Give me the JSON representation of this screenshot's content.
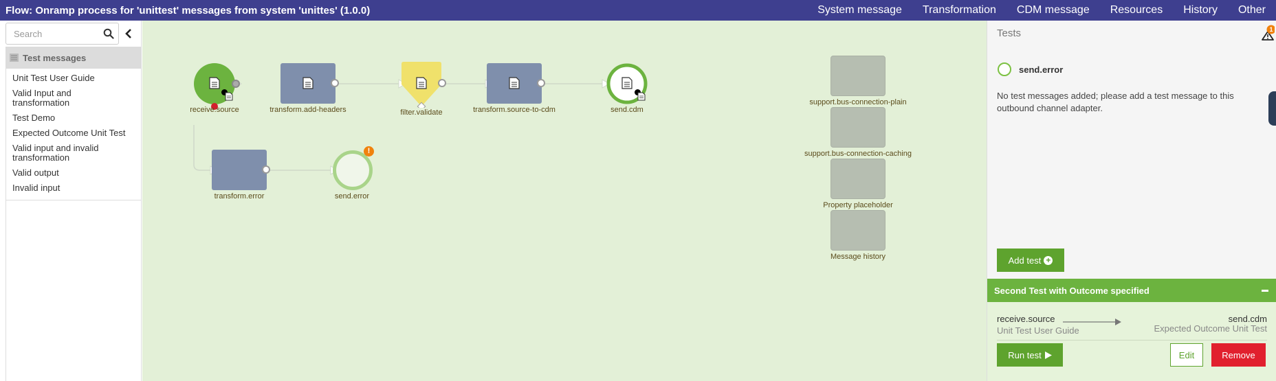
{
  "window": {
    "title": "Flow: Onramp process for 'unittest' messages from system 'unittes' (1.0.0)"
  },
  "nav": [
    {
      "label": "System message"
    },
    {
      "label": "Transformation"
    },
    {
      "label": "CDM message"
    },
    {
      "label": "Resources"
    },
    {
      "label": "History"
    },
    {
      "label": "Other"
    }
  ],
  "sidebar": {
    "search_placeholder": "Search",
    "section_title": "Test messages",
    "items": [
      {
        "label": "Unit Test User Guide"
      },
      {
        "label": "Valid Input and transformation"
      },
      {
        "label": "Test Demo"
      },
      {
        "label": "Expected Outcome Unit Test"
      },
      {
        "label": "Valid input and invalid transformation"
      },
      {
        "label": "Valid output"
      },
      {
        "label": "Invalid input"
      }
    ]
  },
  "flow": {
    "nodes": {
      "receive_source": "receive.source",
      "transform_add_headers": "transform.add-headers",
      "filter_validate": "filter.validate",
      "transform_source_to_cdm": "transform.source-to-cdm",
      "send_cdm": "send.cdm",
      "transform_error": "transform.error",
      "send_error": "send.error"
    },
    "support": {
      "plain": "support.bus-connection-plain",
      "caching": "support.bus-connection-caching",
      "property": "Property placeholder",
      "history": "Message history"
    }
  },
  "tests_panel": {
    "title": "Tests",
    "warning_count": "1",
    "selected_adapter": "send.error",
    "empty_message": "No test messages added; please add a test message to this outbound channel adapter.",
    "add_button": "Add test",
    "accordion": {
      "title": "Second Test with Outcome specified",
      "from_node": "receive.source",
      "from_message": "Unit Test User Guide",
      "to_node": "send.cdm",
      "to_message": "Expected Outcome Unit Test",
      "run_button": "Run test",
      "edit_button": "Edit",
      "remove_button": "Remove"
    }
  },
  "colors": {
    "topbar": "#3e3f8f",
    "canvas": "#e3f0d7",
    "node_green": "#6cb33f",
    "node_blue": "#7f8fac",
    "filter_yellow": "#f0e16b",
    "danger": "#e1202e",
    "warning": "#f0820e"
  },
  "icons": {
    "search": "search-icon",
    "collapse": "chevron-left-icon",
    "warning": "warning-triangle-icon",
    "document": "document-icon",
    "plus": "plus-circle-icon",
    "play": "play-icon"
  }
}
